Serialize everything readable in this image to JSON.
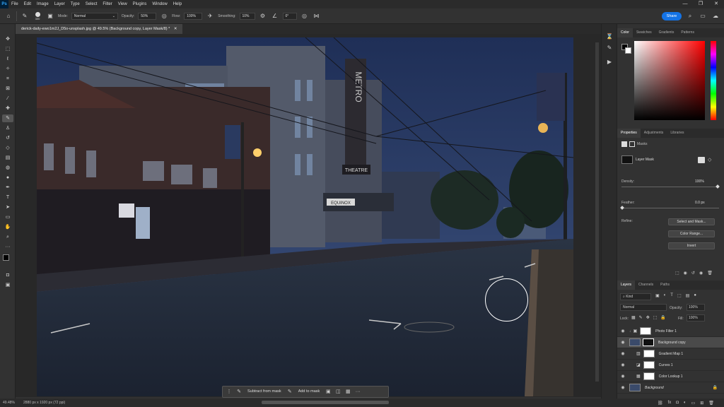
{
  "app": {
    "logo": "Ps"
  },
  "menu": [
    "File",
    "Edit",
    "Image",
    "Layer",
    "Type",
    "Select",
    "Filter",
    "View",
    "Plugins",
    "Window",
    "Help"
  ],
  "window_controls": [
    "—",
    "❐",
    "✕"
  ],
  "options_bar": {
    "brush_size": "300",
    "mode_label": "Mode:",
    "mode_value": "Normal",
    "opacity_label": "Opacity:",
    "opacity_value": "50%",
    "flow_label": "Flow:",
    "flow_value": "100%",
    "smoothing_label": "Smoothing:",
    "smoothing_value": "10%",
    "angle_value": "0°",
    "share_label": "Share"
  },
  "document_tab": "derick-daily-ewo1m2J_D5o-unsplash.jpg @ 49.5% (Background copy, Layer Mask/8) *",
  "contextual_bar": {
    "subtract": "Subtract from mask",
    "add": "Add to mask",
    "more": "···"
  },
  "status": {
    "zoom": "49.48%",
    "dimensions": "2880 px x 1920 px (72 ppi)"
  },
  "color_panel": {
    "tabs": [
      "Color",
      "Swatches",
      "Gradients",
      "Patterns"
    ],
    "hue_color": "#ff0000"
  },
  "properties_panel": {
    "tabs": [
      "Properties",
      "Adjustments",
      "Libraries"
    ],
    "section": "Masks",
    "mask_type": "Layer Mask",
    "density_label": "Density:",
    "density_value": "100%",
    "feather_label": "Feather:",
    "feather_value": "0.0 px",
    "refine_label": "Refine:",
    "select_mask": "Select and Mask...",
    "color_range": "Color Range...",
    "invert": "Invert"
  },
  "layers_panel": {
    "tabs": [
      "Layers",
      "Channels",
      "Paths"
    ],
    "kind_value": "Kind",
    "blend_value": "Normal",
    "opacity_label": "Opacity:",
    "opacity_value": "100%",
    "lock_label": "Lock:",
    "fill_label": "Fill:",
    "fill_value": "100%",
    "layers": [
      {
        "name": "Photo Filter 1"
      },
      {
        "name": "Background copy"
      },
      {
        "name": "Gradient Map 1"
      },
      {
        "name": "Curves 1"
      },
      {
        "name": "Color Lookup 1"
      },
      {
        "name": "Background"
      }
    ],
    "footer_icons": [
      "fx"
    ]
  },
  "photo": {
    "sign_metro": "METRO",
    "sign_theatre": "THEATRE",
    "sign_equinox": "EQUINOX"
  }
}
